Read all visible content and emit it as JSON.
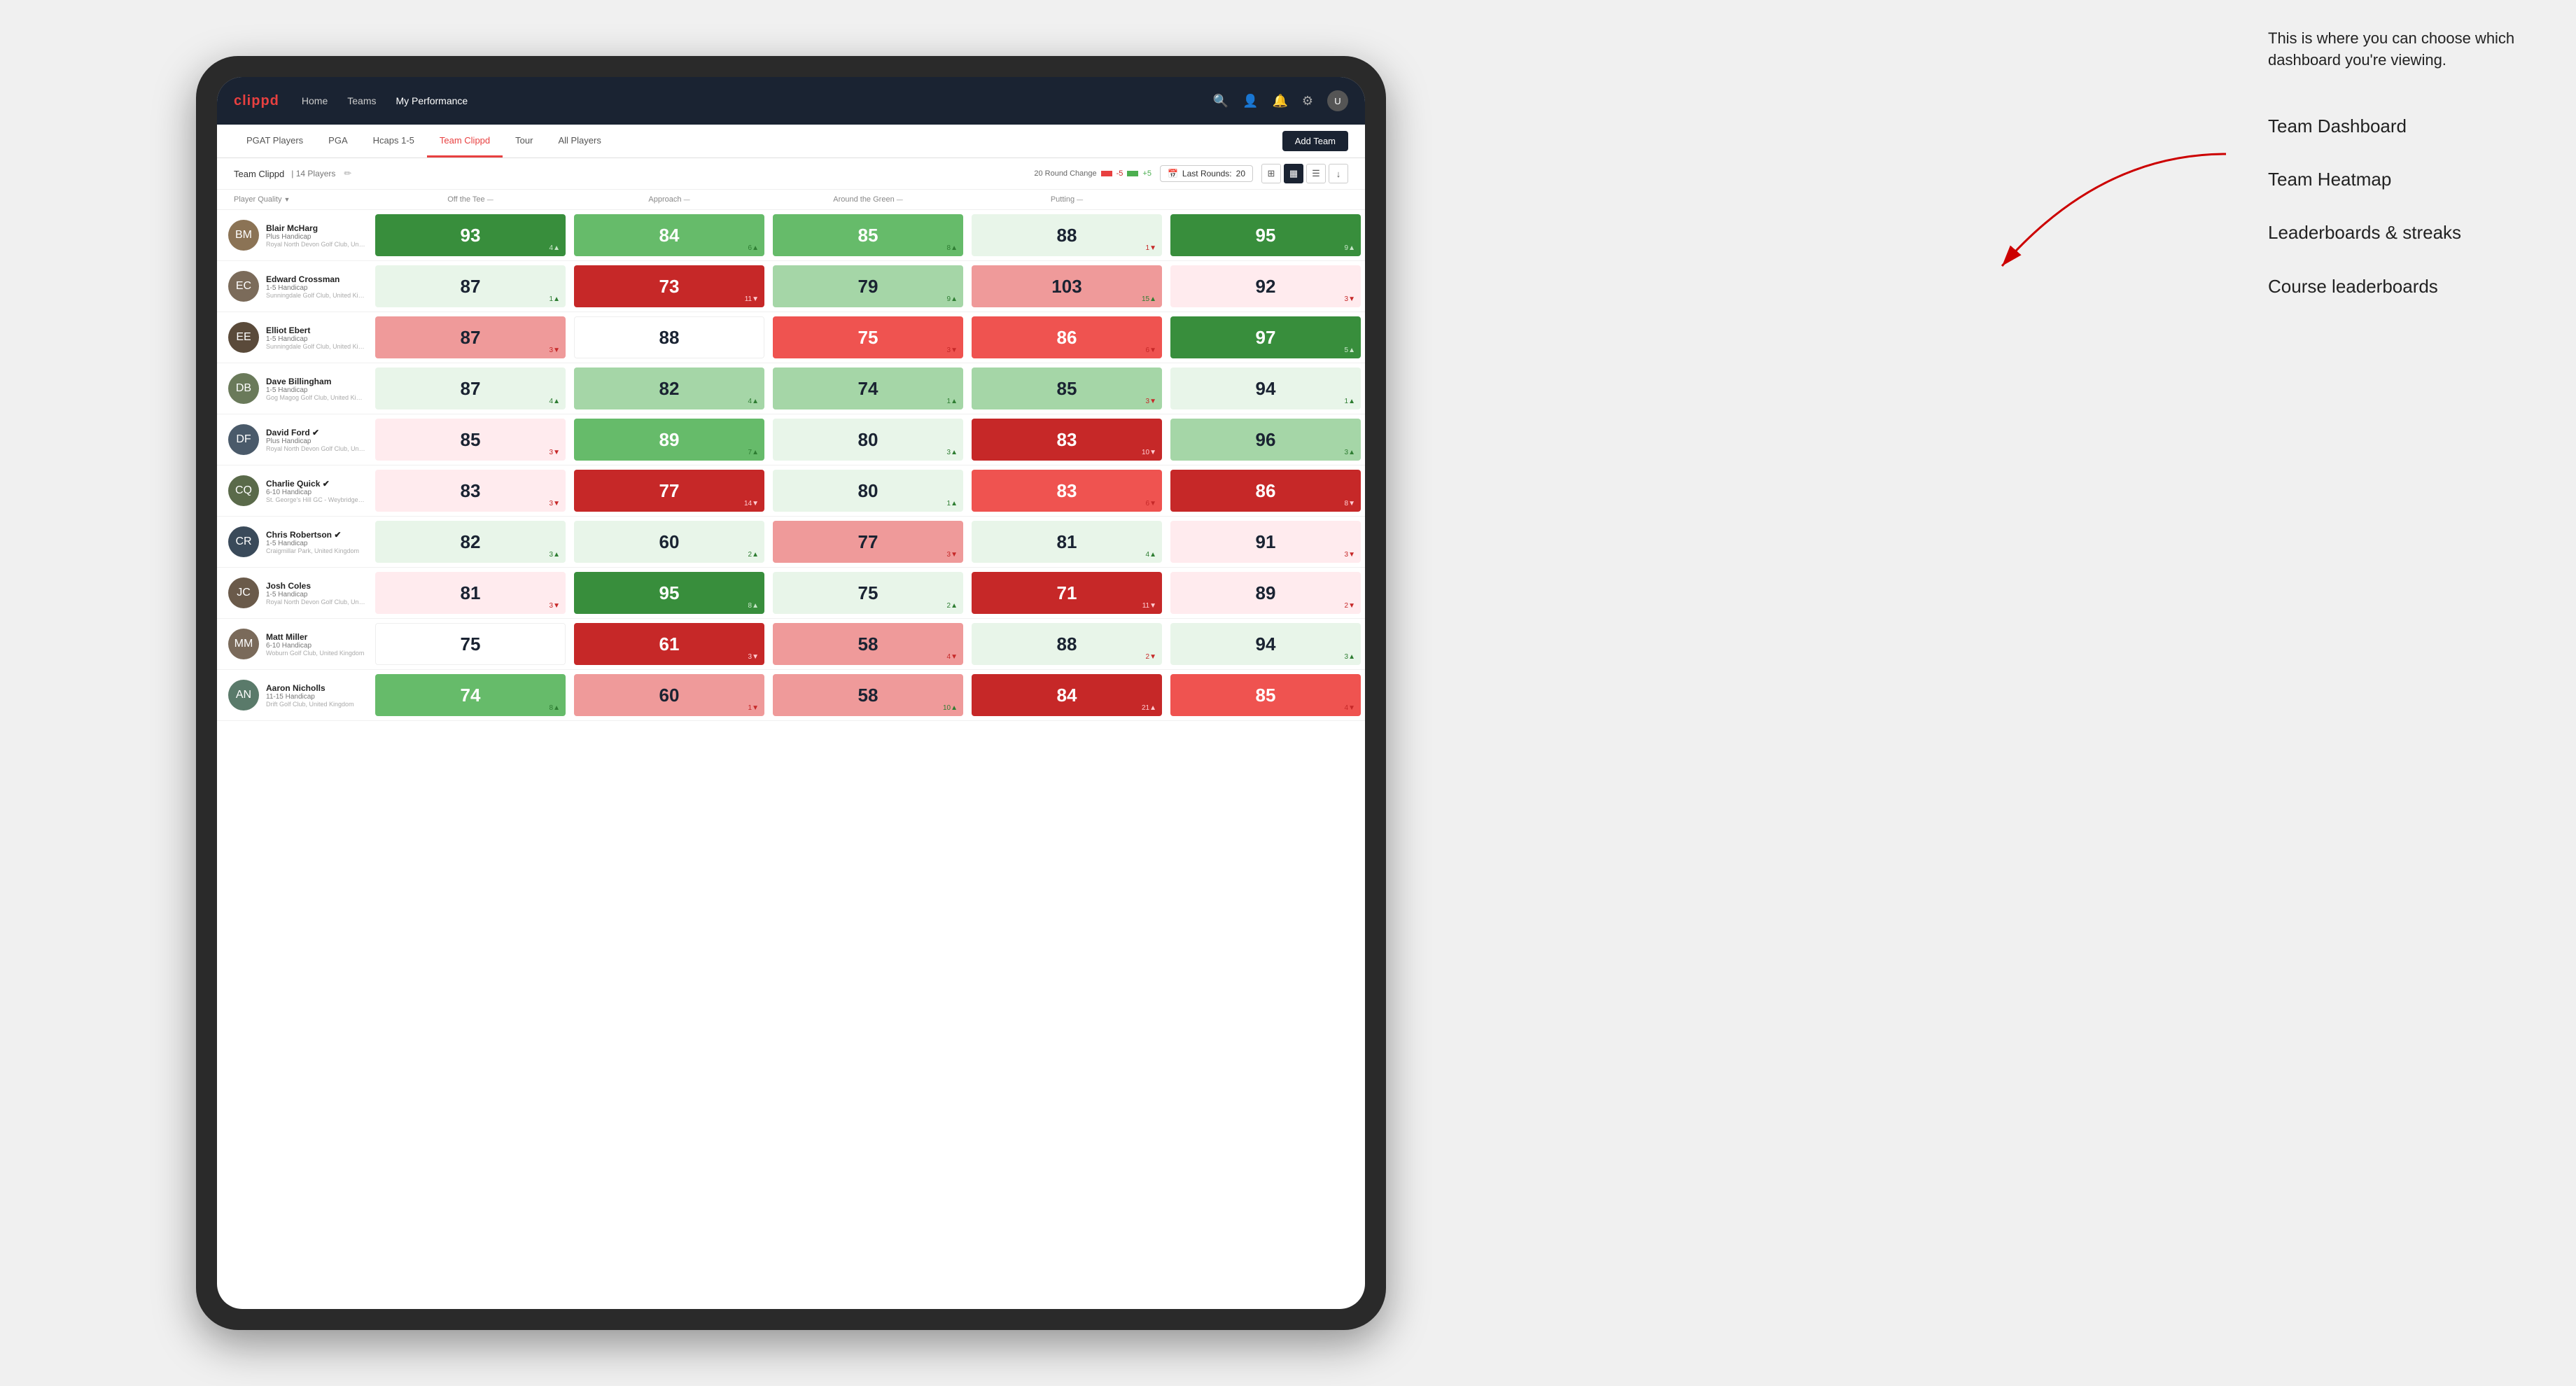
{
  "annotation": {
    "description": "This is where you can choose which dashboard you're viewing.",
    "items": [
      "Team Dashboard",
      "Team Heatmap",
      "Leaderboards & streaks",
      "Course leaderboards"
    ]
  },
  "nav": {
    "logo": "clippd",
    "links": [
      "Home",
      "Teams",
      "My Performance"
    ],
    "active_link": "My Performance"
  },
  "sub_tabs": {
    "tabs": [
      "PGAT Players",
      "PGA",
      "Hcaps 1-5",
      "Team Clippd",
      "Tour",
      "All Players"
    ],
    "active": "Team Clippd",
    "add_team_label": "Add Team"
  },
  "team_info": {
    "name": "Team Clippd",
    "separator": "|",
    "count": "14 Players",
    "round_change_label": "20 Round Change",
    "round_change_neg": "-5",
    "round_change_pos": "+5",
    "last_rounds_label": "Last Rounds:",
    "last_rounds_val": "20"
  },
  "columns": [
    {
      "label": "Player Quality",
      "sort": "▼"
    },
    {
      "label": "Off the Tee",
      "sort": "—"
    },
    {
      "label": "Approach",
      "sort": "—"
    },
    {
      "label": "Around the Green",
      "sort": "—"
    },
    {
      "label": "Putting",
      "sort": "—"
    }
  ],
  "players": [
    {
      "name": "Blair McHarg",
      "hcp": "Plus Handicap",
      "club": "Royal North Devon Golf Club, United Kingdom",
      "avatar_color": "#8B7355",
      "initials": "BM",
      "scores": [
        {
          "val": "93",
          "delta": "4",
          "dir": "up",
          "bg": "bg-green-strong"
        },
        {
          "val": "84",
          "delta": "6",
          "dir": "up",
          "bg": "bg-green-med"
        },
        {
          "val": "85",
          "delta": "8",
          "dir": "up",
          "bg": "bg-green-med"
        },
        {
          "val": "88",
          "delta": "1",
          "dir": "down",
          "bg": "bg-green-vlight"
        },
        {
          "val": "95",
          "delta": "9",
          "dir": "up",
          "bg": "bg-green-strong"
        }
      ]
    },
    {
      "name": "Edward Crossman",
      "hcp": "1-5 Handicap",
      "club": "Sunningdale Golf Club, United Kingdom",
      "avatar_color": "#7B6B5A",
      "initials": "EC",
      "scores": [
        {
          "val": "87",
          "delta": "1",
          "dir": "up",
          "bg": "bg-green-vlight"
        },
        {
          "val": "73",
          "delta": "11",
          "dir": "down",
          "bg": "bg-red-strong"
        },
        {
          "val": "79",
          "delta": "9",
          "dir": "up",
          "bg": "bg-green-light"
        },
        {
          "val": "103",
          "delta": "15",
          "dir": "up",
          "bg": "bg-red-light"
        },
        {
          "val": "92",
          "delta": "3",
          "dir": "down",
          "bg": "bg-red-vlight"
        }
      ]
    },
    {
      "name": "Elliot Ebert",
      "hcp": "1-5 Handicap",
      "club": "Sunningdale Golf Club, United Kingdom",
      "avatar_color": "#5A4A3A",
      "initials": "EE",
      "scores": [
        {
          "val": "87",
          "delta": "3",
          "dir": "down",
          "bg": "bg-red-light"
        },
        {
          "val": "88",
          "delta": "",
          "dir": "neutral",
          "bg": "bg-white"
        },
        {
          "val": "75",
          "delta": "3",
          "dir": "down",
          "bg": "bg-red-med"
        },
        {
          "val": "86",
          "delta": "6",
          "dir": "down",
          "bg": "bg-red-med"
        },
        {
          "val": "97",
          "delta": "5",
          "dir": "up",
          "bg": "bg-green-strong"
        }
      ]
    },
    {
      "name": "Dave Billingham",
      "hcp": "1-5 Handicap",
      "club": "Gog Magog Golf Club, United Kingdom",
      "avatar_color": "#6A7A5A",
      "initials": "DB",
      "scores": [
        {
          "val": "87",
          "delta": "4",
          "dir": "up",
          "bg": "bg-green-vlight"
        },
        {
          "val": "82",
          "delta": "4",
          "dir": "up",
          "bg": "bg-green-light"
        },
        {
          "val": "74",
          "delta": "1",
          "dir": "up",
          "bg": "bg-green-light"
        },
        {
          "val": "85",
          "delta": "3",
          "dir": "down",
          "bg": "bg-green-light"
        },
        {
          "val": "94",
          "delta": "1",
          "dir": "up",
          "bg": "bg-green-vlight"
        }
      ]
    },
    {
      "name": "David Ford",
      "hcp": "Plus Handicap",
      "club": "Royal North Devon Golf Club, United Kingdom",
      "avatar_color": "#4A5A6A",
      "initials": "DF",
      "verified": true,
      "scores": [
        {
          "val": "85",
          "delta": "3",
          "dir": "down",
          "bg": "bg-red-vlight"
        },
        {
          "val": "89",
          "delta": "7",
          "dir": "up",
          "bg": "bg-green-med"
        },
        {
          "val": "80",
          "delta": "3",
          "dir": "up",
          "bg": "bg-green-vlight"
        },
        {
          "val": "83",
          "delta": "10",
          "dir": "down",
          "bg": "bg-red-strong"
        },
        {
          "val": "96",
          "delta": "3",
          "dir": "up",
          "bg": "bg-green-light"
        }
      ]
    },
    {
      "name": "Charlie Quick",
      "hcp": "6-10 Handicap",
      "club": "St. George's Hill GC - Weybridge - Surrey, Uni...",
      "avatar_color": "#5A6A4A",
      "initials": "CQ",
      "verified": true,
      "scores": [
        {
          "val": "83",
          "delta": "3",
          "dir": "down",
          "bg": "bg-red-vlight"
        },
        {
          "val": "77",
          "delta": "14",
          "dir": "down",
          "bg": "bg-red-strong"
        },
        {
          "val": "80",
          "delta": "1",
          "dir": "up",
          "bg": "bg-green-vlight"
        },
        {
          "val": "83",
          "delta": "6",
          "dir": "down",
          "bg": "bg-red-med"
        },
        {
          "val": "86",
          "delta": "8",
          "dir": "down",
          "bg": "bg-red-strong"
        }
      ]
    },
    {
      "name": "Chris Robertson",
      "hcp": "1-5 Handicap",
      "club": "Craigmillar Park, United Kingdom",
      "avatar_color": "#3A4A5A",
      "initials": "CR",
      "verified": true,
      "scores": [
        {
          "val": "82",
          "delta": "3",
          "dir": "up",
          "bg": "bg-green-vlight"
        },
        {
          "val": "60",
          "delta": "2",
          "dir": "up",
          "bg": "bg-green-vlight"
        },
        {
          "val": "77",
          "delta": "3",
          "dir": "down",
          "bg": "bg-red-light"
        },
        {
          "val": "81",
          "delta": "4",
          "dir": "up",
          "bg": "bg-green-vlight"
        },
        {
          "val": "91",
          "delta": "3",
          "dir": "down",
          "bg": "bg-red-vlight"
        }
      ]
    },
    {
      "name": "Josh Coles",
      "hcp": "1-5 Handicap",
      "club": "Royal North Devon Golf Club, United Kingdom",
      "avatar_color": "#6A5A4A",
      "initials": "JC",
      "scores": [
        {
          "val": "81",
          "delta": "3",
          "dir": "down",
          "bg": "bg-red-vlight"
        },
        {
          "val": "95",
          "delta": "8",
          "dir": "up",
          "bg": "bg-green-strong"
        },
        {
          "val": "75",
          "delta": "2",
          "dir": "up",
          "bg": "bg-green-vlight"
        },
        {
          "val": "71",
          "delta": "11",
          "dir": "down",
          "bg": "bg-red-strong"
        },
        {
          "val": "89",
          "delta": "2",
          "dir": "down",
          "bg": "bg-red-vlight"
        }
      ]
    },
    {
      "name": "Matt Miller",
      "hcp": "6-10 Handicap",
      "club": "Woburn Golf Club, United Kingdom",
      "avatar_color": "#7A6A5A",
      "initials": "MM",
      "scores": [
        {
          "val": "75",
          "delta": "",
          "dir": "neutral",
          "bg": "bg-white"
        },
        {
          "val": "61",
          "delta": "3",
          "dir": "down",
          "bg": "bg-red-strong"
        },
        {
          "val": "58",
          "delta": "4",
          "dir": "down",
          "bg": "bg-red-light"
        },
        {
          "val": "88",
          "delta": "2",
          "dir": "down",
          "bg": "bg-green-vlight"
        },
        {
          "val": "94",
          "delta": "3",
          "dir": "up",
          "bg": "bg-green-vlight"
        }
      ]
    },
    {
      "name": "Aaron Nicholls",
      "hcp": "11-15 Handicap",
      "club": "Drift Golf Club, United Kingdom",
      "avatar_color": "#5A7A6A",
      "initials": "AN",
      "scores": [
        {
          "val": "74",
          "delta": "8",
          "dir": "up",
          "bg": "bg-green-med"
        },
        {
          "val": "60",
          "delta": "1",
          "dir": "down",
          "bg": "bg-red-light"
        },
        {
          "val": "58",
          "delta": "10",
          "dir": "up",
          "bg": "bg-red-light"
        },
        {
          "val": "84",
          "delta": "21",
          "dir": "up",
          "bg": "bg-red-strong"
        },
        {
          "val": "85",
          "delta": "4",
          "dir": "down",
          "bg": "bg-red-med"
        }
      ]
    }
  ]
}
